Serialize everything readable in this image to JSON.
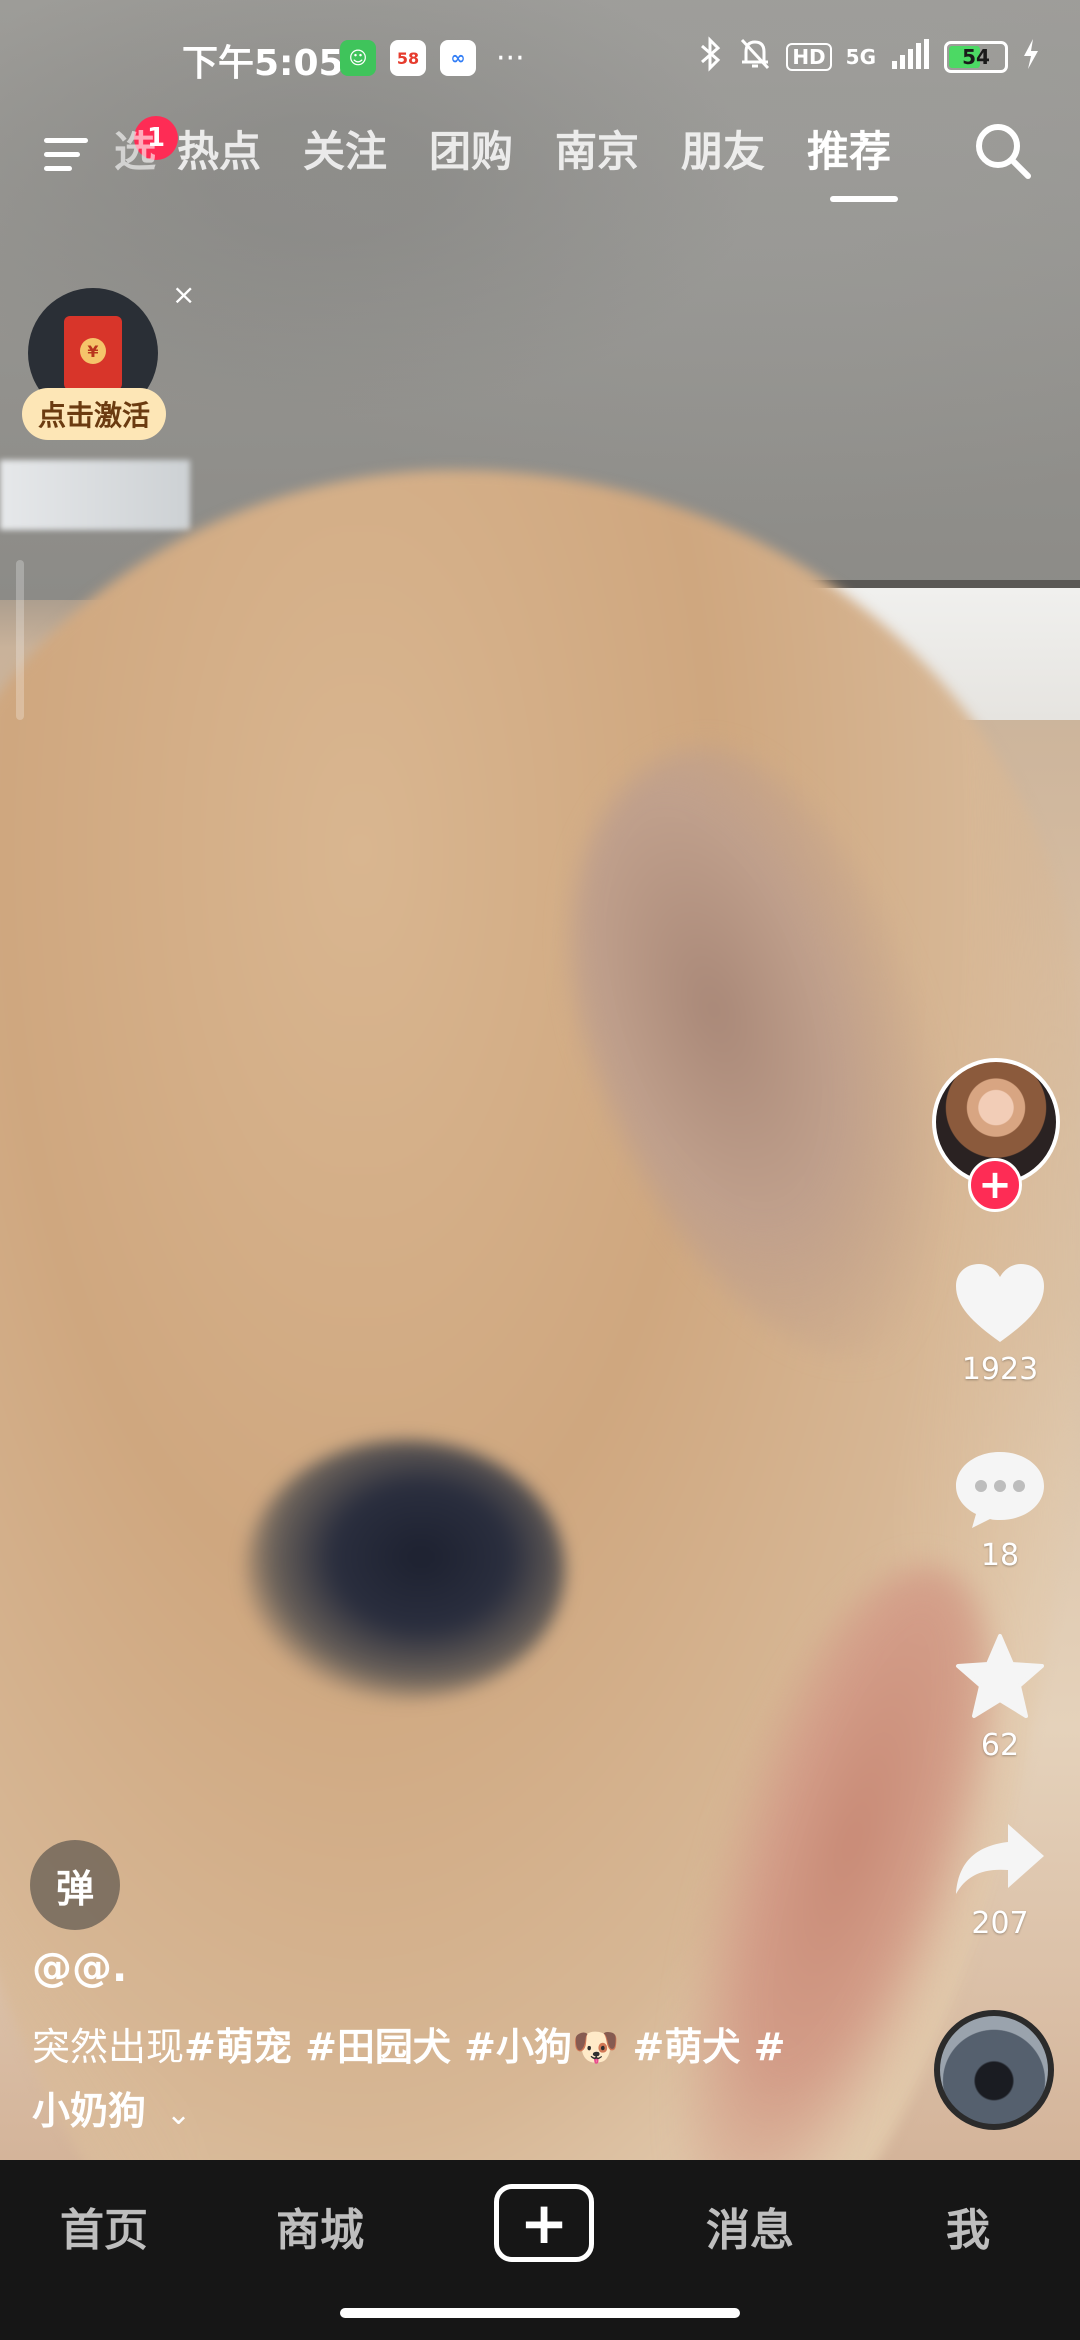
{
  "status_bar": {
    "time": "下午5:05",
    "app_icons": [
      "android-app-icon",
      "58-app-icon",
      "cloud-app-icon"
    ],
    "more": "···",
    "network": "5G",
    "hd": "HD",
    "battery": "54",
    "battery_level": 0.54
  },
  "top_nav": {
    "notification_count": "1",
    "tabs": [
      {
        "label": "选",
        "partial": true
      },
      {
        "label": "热点"
      },
      {
        "label": "关注"
      },
      {
        "label": "团购"
      },
      {
        "label": "南京"
      },
      {
        "label": "朋友"
      },
      {
        "label": "推荐",
        "active": true
      }
    ]
  },
  "red_packet": {
    "seal": "¥",
    "close": "×",
    "label": "点击激活"
  },
  "actions": {
    "follow": "+",
    "likes": "1923",
    "comments": "18",
    "favorites": "62",
    "shares": "207"
  },
  "video_info": {
    "danmu_label": "弹",
    "author": "@@.",
    "caption_lead": "突然出现",
    "tags_line1": "#萌宠 #田园犬 #小狗🐶 #萌犬 #",
    "tags_line2": "小奶狗",
    "expand_icon": "⌄"
  },
  "bottom_nav": {
    "home": "首页",
    "mall": "商城",
    "create": "+",
    "messages": "消息",
    "me": "我"
  },
  "colors": {
    "accent": "#fe2c55",
    "nav_bg": "#161616",
    "red_packet_label_bg": "#fde6b6"
  }
}
